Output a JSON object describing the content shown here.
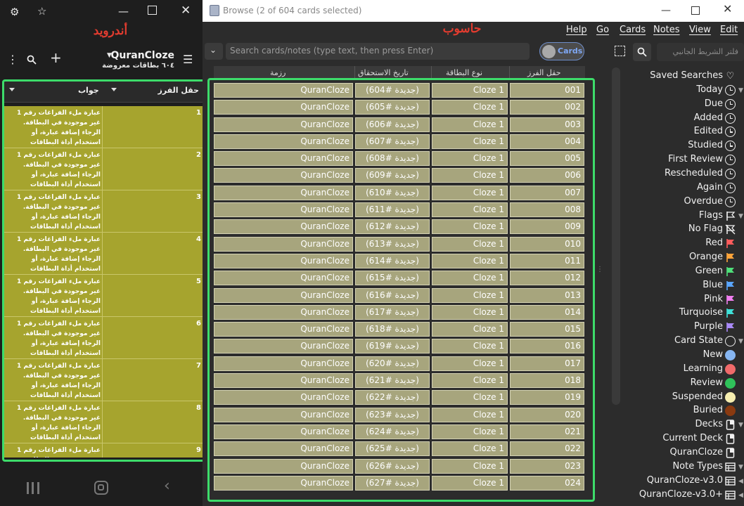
{
  "android": {
    "label": "أندرويد",
    "header": {
      "deck_title": "QuranCloze",
      "subtitle": "٦٠٤ بطاقات معروضة"
    },
    "columns": {
      "sort_field": "حقل الفرز",
      "answer": "جواب"
    },
    "row_numbers": [
      "1",
      "2",
      "3",
      "4",
      "5",
      "6",
      "7",
      "8",
      "9"
    ],
    "answer_text": "عبارة ملء الفراغات رقم 1 غير موجودة في البطاقة. الرجاء إضافة عبارة، أو استخدام أداة البطاقات الفارغة. المزيد من المعلومات",
    "icons": [
      "settings-icon",
      "bookmark-star-icon",
      "minimize-icon",
      "maximize-icon",
      "close-icon",
      "more-vert-icon",
      "search-icon",
      "add-icon",
      "dropdown-icon",
      "hamburger-icon",
      "recents-icon",
      "home-icon",
      "back-icon"
    ]
  },
  "desktop": {
    "label": "حاسوب",
    "window_title": "Browse (2 of 604 cards selected)",
    "menu": [
      "Help",
      "Go",
      "Cards",
      "Notes",
      "View",
      "Edit"
    ],
    "search_placeholder": "Search cards/notes (type text, then press Enter)",
    "toggle_label": "Cards",
    "sidebar_search_placeholder": "فلتر الشريط الجانبي",
    "columns": {
      "deck": "رزمة",
      "due": "تاريخ الاستحقاق",
      "card_type": "نوع البطاقة",
      "sort_field": "حقل الفرز"
    },
    "rows": [
      {
        "sort": "001",
        "type": "Cloze 1",
        "due": "(جديدة #604)",
        "deck": "QuranCloze"
      },
      {
        "sort": "002",
        "type": "Cloze 1",
        "due": "(جديدة #605)",
        "deck": "QuranCloze"
      },
      {
        "sort": "003",
        "type": "Cloze 1",
        "due": "(جديدة #606)",
        "deck": "QuranCloze"
      },
      {
        "sort": "004",
        "type": "Cloze 1",
        "due": "(جديدة #607)",
        "deck": "QuranCloze"
      },
      {
        "sort": "005",
        "type": "Cloze 1",
        "due": "(جديدة #608)",
        "deck": "QuranCloze"
      },
      {
        "sort": "006",
        "type": "Cloze 1",
        "due": "(جديدة #609)",
        "deck": "QuranCloze"
      },
      {
        "sort": "007",
        "type": "Cloze 1",
        "due": "(جديدة #610)",
        "deck": "QuranCloze"
      },
      {
        "sort": "008",
        "type": "Cloze 1",
        "due": "(جديدة #611)",
        "deck": "QuranCloze"
      },
      {
        "sort": "009",
        "type": "Cloze 1",
        "due": "(جديدة #612)",
        "deck": "QuranCloze"
      },
      {
        "sort": "010",
        "type": "Cloze 1",
        "due": "(جديدة #613)",
        "deck": "QuranCloze"
      },
      {
        "sort": "011",
        "type": "Cloze 1",
        "due": "(جديدة #614)",
        "deck": "QuranCloze"
      },
      {
        "sort": "012",
        "type": "Cloze 1",
        "due": "(جديدة #615)",
        "deck": "QuranCloze"
      },
      {
        "sort": "013",
        "type": "Cloze 1",
        "due": "(جديدة #616)",
        "deck": "QuranCloze"
      },
      {
        "sort": "014",
        "type": "Cloze 1",
        "due": "(جديدة #617)",
        "deck": "QuranCloze"
      },
      {
        "sort": "015",
        "type": "Cloze 1",
        "due": "(جديدة #618)",
        "deck": "QuranCloze"
      },
      {
        "sort": "016",
        "type": "Cloze 1",
        "due": "(جديدة #619)",
        "deck": "QuranCloze"
      },
      {
        "sort": "017",
        "type": "Cloze 1",
        "due": "(جديدة #620)",
        "deck": "QuranCloze"
      },
      {
        "sort": "018",
        "type": "Cloze 1",
        "due": "(جديدة #621)",
        "deck": "QuranCloze"
      },
      {
        "sort": "019",
        "type": "Cloze 1",
        "due": "(جديدة #622)",
        "deck": "QuranCloze"
      },
      {
        "sort": "020",
        "type": "Cloze 1",
        "due": "(جديدة #623)",
        "deck": "QuranCloze"
      },
      {
        "sort": "021",
        "type": "Cloze 1",
        "due": "(جديدة #624)",
        "deck": "QuranCloze"
      },
      {
        "sort": "022",
        "type": "Cloze 1",
        "due": "(جديدة #625)",
        "deck": "QuranCloze"
      },
      {
        "sort": "023",
        "type": "Cloze 1",
        "due": "(جديدة #626)",
        "deck": "QuranCloze"
      },
      {
        "sort": "024",
        "type": "Cloze 1",
        "due": "(جديدة #627)",
        "deck": "QuranCloze"
      }
    ],
    "sidebar": [
      {
        "label": "Saved Searches",
        "icon": "heart-icon",
        "kind": "glyph",
        "glyph": "♡",
        "expand": false
      },
      {
        "label": "Today",
        "icon": "clock-icon",
        "kind": "clock",
        "expand": true
      },
      {
        "label": "Due",
        "icon": "clock-icon",
        "kind": "clock",
        "expand": false
      },
      {
        "label": "Added",
        "icon": "clock-icon",
        "kind": "clock",
        "expand": false
      },
      {
        "label": "Edited",
        "icon": "clock-icon",
        "kind": "clock",
        "expand": false
      },
      {
        "label": "Studied",
        "icon": "clock-icon",
        "kind": "clock",
        "expand": false
      },
      {
        "label": "First Review",
        "icon": "clock-icon",
        "kind": "clock",
        "expand": false
      },
      {
        "label": "Rescheduled",
        "icon": "clock-icon",
        "kind": "clock",
        "expand": false
      },
      {
        "label": "Again",
        "icon": "clock-icon",
        "kind": "clock",
        "expand": false
      },
      {
        "label": "Overdue",
        "icon": "clock-icon",
        "kind": "clock",
        "expand": false
      },
      {
        "label": "Flags",
        "icon": "flag-outline-icon",
        "kind": "glyph",
        "glyph": "⚐",
        "expand": true
      },
      {
        "label": "No Flag",
        "icon": "no-flag-icon",
        "kind": "glyph",
        "glyph": "⚐",
        "expand": false
      },
      {
        "label": "Red",
        "icon": "flag-red-icon",
        "kind": "flag",
        "color": "#ff5c5c",
        "expand": false
      },
      {
        "label": "Orange",
        "icon": "flag-orange-icon",
        "kind": "flag",
        "color": "#ffa43a",
        "expand": false
      },
      {
        "label": "Green",
        "icon": "flag-green-icon",
        "kind": "flag",
        "color": "#4fe07a",
        "expand": false
      },
      {
        "label": "Blue",
        "icon": "flag-blue-icon",
        "kind": "flag",
        "color": "#5aa6ff",
        "expand": false
      },
      {
        "label": "Pink",
        "icon": "flag-pink-icon",
        "kind": "flag",
        "color": "#f07ef0",
        "expand": false
      },
      {
        "label": "Turquoise",
        "icon": "flag-turquoise-icon",
        "kind": "flag",
        "color": "#3fe0d8",
        "expand": false
      },
      {
        "label": "Purple",
        "icon": "flag-purple-icon",
        "kind": "flag",
        "color": "#a98af7",
        "expand": false
      },
      {
        "label": "Card State",
        "icon": "circle-outline-icon",
        "kind": "ring",
        "expand": true
      },
      {
        "label": "New",
        "icon": "dot-new-icon",
        "kind": "dot",
        "color": "#86b6f2",
        "expand": false
      },
      {
        "label": "Learning",
        "icon": "dot-learning-icon",
        "kind": "dot",
        "color": "#f06a6a",
        "expand": false
      },
      {
        "label": "Review",
        "icon": "dot-review-icon",
        "kind": "dot",
        "color": "#2fc25a",
        "expand": false
      },
      {
        "label": "Suspended",
        "icon": "dot-suspended-icon",
        "kind": "dot",
        "color": "#f6eeb0",
        "expand": false
      },
      {
        "label": "Buried",
        "icon": "dot-buried-icon",
        "kind": "dot",
        "color": "#8a3a10",
        "expand": false
      },
      {
        "label": "Decks",
        "icon": "deck-icon",
        "kind": "deck",
        "expand": true
      },
      {
        "label": "Current Deck",
        "icon": "current-deck-icon",
        "kind": "deck",
        "expand": false
      },
      {
        "label": "QuranCloze",
        "icon": "deck-icon",
        "kind": "deck",
        "expand": false
      },
      {
        "label": "Note Types",
        "icon": "note-type-icon",
        "kind": "table",
        "expand": true
      },
      {
        "label": "QuranCloze-v3.0",
        "icon": "note-type-icon",
        "kind": "table",
        "expand": "side"
      },
      {
        "label": "QuranCloze-v3.0+",
        "icon": "note-type-icon",
        "kind": "table",
        "expand": "side"
      }
    ]
  }
}
